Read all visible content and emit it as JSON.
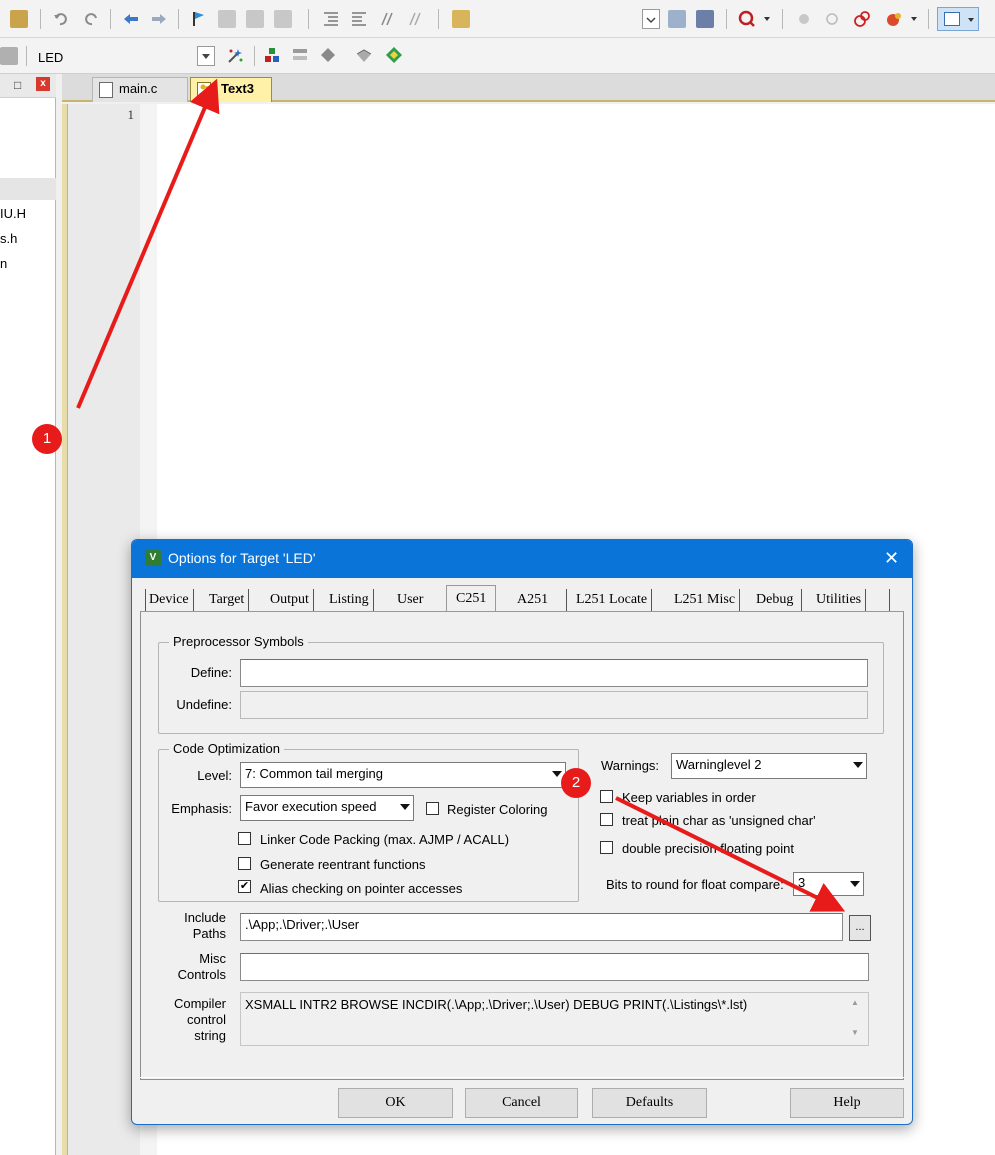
{
  "toolbar": {
    "target_name": "LED"
  },
  "project_panel": {
    "pin_icon": "pin-icon",
    "files": [
      "IU.H",
      "s.h",
      "n"
    ]
  },
  "editor": {
    "tabs": [
      {
        "label": "main.c"
      },
      {
        "label": "Text3"
      }
    ],
    "line_number": "1"
  },
  "dialog": {
    "title": "Options for Target 'LED'",
    "tabs": [
      "Device",
      "Target",
      "Output",
      "Listing",
      "User",
      "C251",
      "A251",
      "L251 Locate",
      "L251 Misc",
      "Debug",
      "Utilities"
    ],
    "active_tab": "C251",
    "preprocessor": {
      "group_title": "Preprocessor Symbols",
      "define_label": "Define:",
      "define_value": "",
      "undefine_label": "Undefine:",
      "undefine_value": ""
    },
    "optimization": {
      "group_title": "Code Optimization",
      "level_label": "Level:",
      "level_value": "7: Common tail merging",
      "emphasis_label": "Emphasis:",
      "emphasis_value": "Favor execution speed",
      "register_coloring": {
        "label": "Register Coloring",
        "checked": false
      },
      "linker_packing": {
        "label": "Linker Code Packing (max. AJMP / ACALL)",
        "checked": false
      },
      "reentrant": {
        "label": "Generate reentrant functions",
        "checked": false
      },
      "alias_checking": {
        "label": "Alias checking on pointer accesses",
        "checked": true
      }
    },
    "warnings": {
      "label": "Warnings:",
      "value": "Warninglevel 2",
      "keep_vars": {
        "label": "Keep variables in order",
        "checked": false
      },
      "plain_char": {
        "label": "treat plain char as 'unsigned char'",
        "checked": false
      },
      "double_precision": {
        "label": "double precision floating point",
        "checked": false
      },
      "bits_round_label": "Bits to round for float compare:",
      "bits_round_value": "3"
    },
    "include_paths": {
      "label_line1": "Include",
      "label_line2": "Paths",
      "value": ".\\App;.\\Driver;.\\User",
      "browse_label": "..."
    },
    "misc_controls": {
      "label_line1": "Misc",
      "label_line2": "Controls",
      "value": ""
    },
    "compiler_control": {
      "label_line1": "Compiler",
      "label_line2": "control",
      "label_line3": "string",
      "value": "XSMALL INTR2 BROWSE INCDIR(.\\App;.\\Driver;.\\User) DEBUG PRINT(.\\Listings\\*.lst)"
    },
    "buttons": {
      "ok": "OK",
      "cancel": "Cancel",
      "defaults": "Defaults",
      "help": "Help"
    }
  },
  "annotations": {
    "badge1": "1",
    "badge2": "2",
    "color": "#e81b1b"
  }
}
